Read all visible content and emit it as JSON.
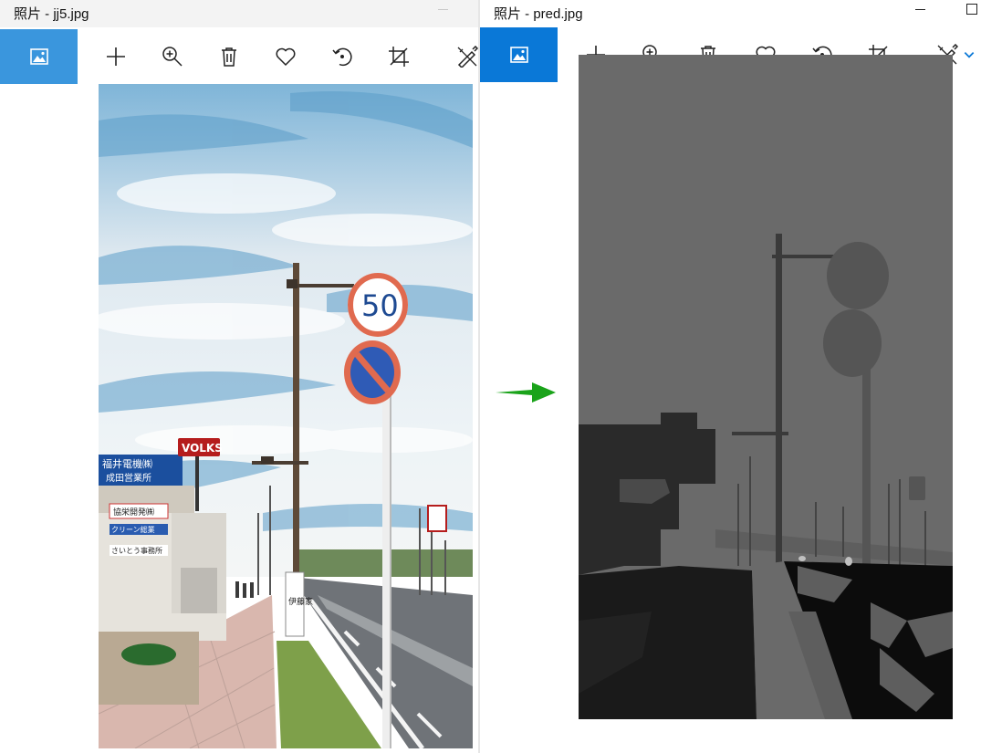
{
  "left_window": {
    "title": "照片 - jj5.jpg",
    "toolbar": {
      "tile_icon": "image-icon",
      "tools": [
        "add-icon",
        "zoom-in-icon",
        "delete-icon",
        "favorite-icon",
        "rotate-icon",
        "crop-icon",
        "edit-icon"
      ]
    },
    "photo_signs": {
      "speed_limit": "50",
      "store_sign_1": "福井電機㈱",
      "store_sign_2": "成田営業所",
      "store_sign_3": "協栄開発㈱",
      "store_sign_4": "クリーン総業",
      "store_sign_5": "さいとう事務所",
      "brand_sign": "VOLKS",
      "pole_sign": "伊藤家"
    }
  },
  "right_window": {
    "title": "照片 - pred.jpg",
    "toolbar": {
      "tile_icon": "image-icon",
      "tools": [
        "add-icon",
        "zoom-in-icon",
        "delete-icon",
        "favorite-icon",
        "rotate-icon",
        "crop-icon",
        "edit-icon",
        "chevron-down-icon"
      ]
    }
  },
  "colors": {
    "left_tile": "#3a96dd",
    "right_tile": "#0a78d7",
    "arrow": "#1aa31a",
    "mask_sky": "#6a6a6a",
    "mask_sign": "#555555",
    "mask_building": "#2a2a2a",
    "mask_road": "#0c0c0c",
    "mask_vegetation": "#5e5e5e"
  }
}
